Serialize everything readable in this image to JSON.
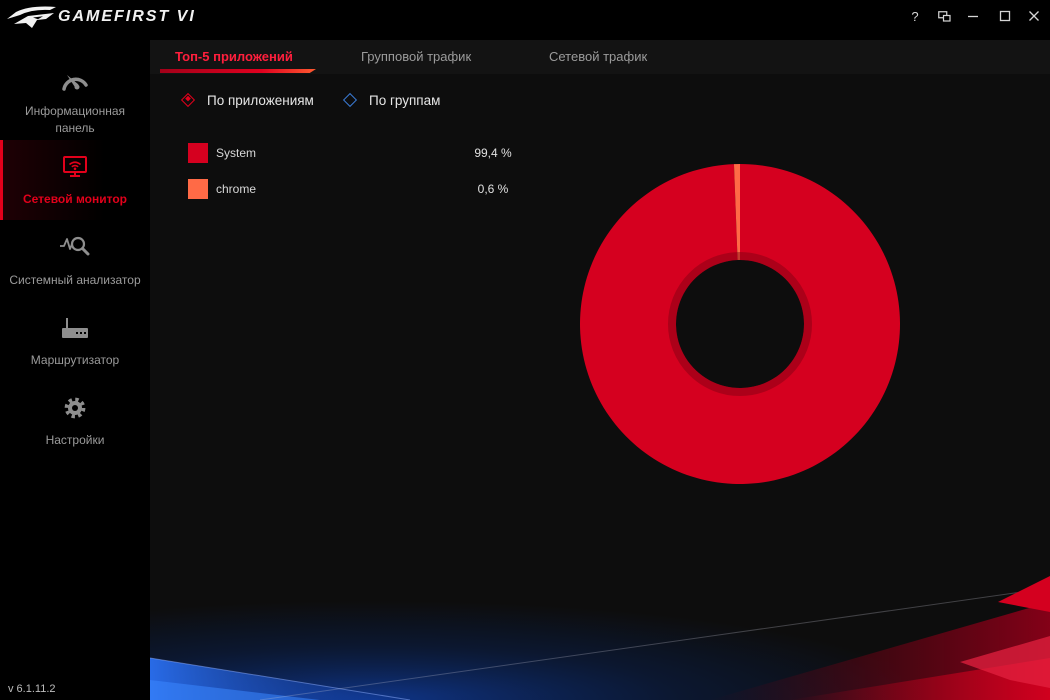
{
  "window": {
    "app_title": "GAMEFIRST VI",
    "help_label": "?",
    "logo_icon": "rog-eye-logo",
    "controls": [
      "mini-mode-icon",
      "minimize-icon",
      "maximize-icon",
      "close-icon"
    ]
  },
  "sidebar": {
    "items": [
      {
        "label": "Информационная панель",
        "icon": "dashboard-gauge-icon",
        "active": false
      },
      {
        "label": "Сетевой монитор",
        "icon": "network-monitor-icon",
        "active": true
      },
      {
        "label": "Системный анализатор",
        "icon": "system-analyzer-icon",
        "active": false
      },
      {
        "label": "Маршрутизатор",
        "icon": "router-icon",
        "active": false
      },
      {
        "label": "Настройки",
        "icon": "settings-gear-icon",
        "active": false
      }
    ],
    "version": "v 6.1.11.2"
  },
  "tabs": {
    "items": [
      {
        "label": "Топ-5 приложений",
        "active": true
      },
      {
        "label": "Групповой трафик",
        "active": false
      },
      {
        "label": "Сетевой трафик",
        "active": false
      }
    ]
  },
  "view_mode": {
    "options": [
      {
        "label": "По приложениям",
        "selected": true
      },
      {
        "label": "По группам",
        "selected": false
      }
    ]
  },
  "colors": {
    "accent": "#e3001b",
    "unselected_radio": "#3a7bd5",
    "inactive_text": "#9b9b9b"
  },
  "chart_data": {
    "type": "pie",
    "donut": true,
    "categories": [
      "System",
      "chrome"
    ],
    "values": [
      99.4,
      0.6
    ],
    "value_labels": [
      "99,4 %",
      "0,6 %"
    ],
    "colors": [
      "#d5001f",
      "#ff6a46"
    ],
    "legend": "left"
  }
}
